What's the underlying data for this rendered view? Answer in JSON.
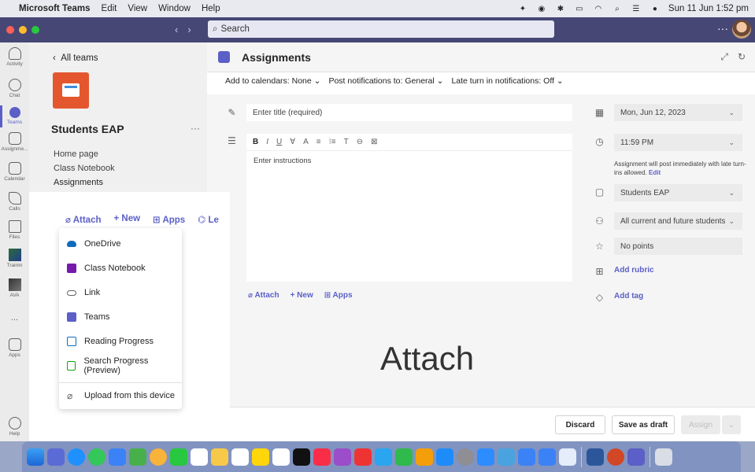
{
  "menubar": {
    "app_name": "Microsoft Teams",
    "items": [
      "Edit",
      "View",
      "Window",
      "Help"
    ],
    "datetime": "Sun 11 Jun  1:52 pm"
  },
  "titlebar": {
    "search_placeholder": "Search",
    "more": "···"
  },
  "rail": {
    "items": [
      {
        "label": "Activity",
        "icon": "bell-icon"
      },
      {
        "label": "Chat",
        "icon": "chat-icon"
      },
      {
        "label": "Teams",
        "icon": "teams-icon",
        "active": true
      },
      {
        "label": "Assignme...",
        "icon": "assignments-icon"
      },
      {
        "label": "Calendar",
        "icon": "calendar-icon"
      },
      {
        "label": "Calls",
        "icon": "phone-icon"
      },
      {
        "label": "Files",
        "icon": "file-icon"
      },
      {
        "label": "Trainin",
        "icon": "app-icon"
      },
      {
        "label": "AVA",
        "icon": "app-icon"
      },
      {
        "label": "...",
        "icon": "more-icon"
      },
      {
        "label": "Apps",
        "icon": "apps-icon"
      },
      {
        "label": "Help",
        "icon": "help-icon"
      }
    ]
  },
  "teampanel": {
    "back_label": "All teams",
    "team_name": "Students EAP",
    "more": "···",
    "channels": [
      "Home page",
      "Class Notebook",
      "Assignments"
    ]
  },
  "assignment": {
    "title": "Assignments",
    "options": {
      "calendars": "Add to calendars: None",
      "notifications": "Post notifications to: General",
      "late": "Late turn in notifications: Off"
    },
    "title_placeholder": "Enter title (required)",
    "instructions_placeholder": "Enter instructions",
    "toolbar_glyphs": [
      "B",
      "I",
      "U",
      "∀",
      "A",
      "≡",
      "⁝≡",
      "T",
      "⊖",
      "⊠"
    ],
    "attach_row": {
      "attach": "Attach",
      "new": "+ New",
      "apps": "Apps"
    },
    "due_date": "Mon, Jun 12, 2023",
    "due_time": "11:59 PM",
    "post_note": "Assignment will post immediately with late turn-ins allowed.",
    "edit_link": "Edit",
    "class": "Students EAP",
    "students": "All current and future students",
    "points_placeholder": "No points",
    "add_rubric": "Add rubric",
    "add_tag": "Add tag",
    "big_caption": "Attach",
    "footer": {
      "discard": "Discard",
      "save_draft": "Save as draft",
      "assign": "Assign"
    }
  },
  "overlay": {
    "attach": "Attach",
    "new": "+ New",
    "apps": "Apps",
    "le": "Le"
  },
  "attach_menu": {
    "items": [
      {
        "label": "OneDrive",
        "icon": "onedrive-icon",
        "color": "#0f6cbd"
      },
      {
        "label": "Class Notebook",
        "icon": "onenote-icon",
        "color": "#7719aa"
      },
      {
        "label": "Link",
        "icon": "link-icon",
        "color": "#616161"
      },
      {
        "label": "Teams",
        "icon": "teams-icon",
        "color": "#5b5fc7"
      },
      {
        "label": "Reading Progress",
        "icon": "reading-progress-icon",
        "color": "#0f6cbd"
      },
      {
        "label": "Search Progress (Preview)",
        "icon": "search-progress-icon",
        "color": "#13a10e"
      }
    ],
    "upload": "Upload from this device"
  },
  "colors": {
    "accent": "#5b5fc7",
    "titlebar": "#464775"
  }
}
